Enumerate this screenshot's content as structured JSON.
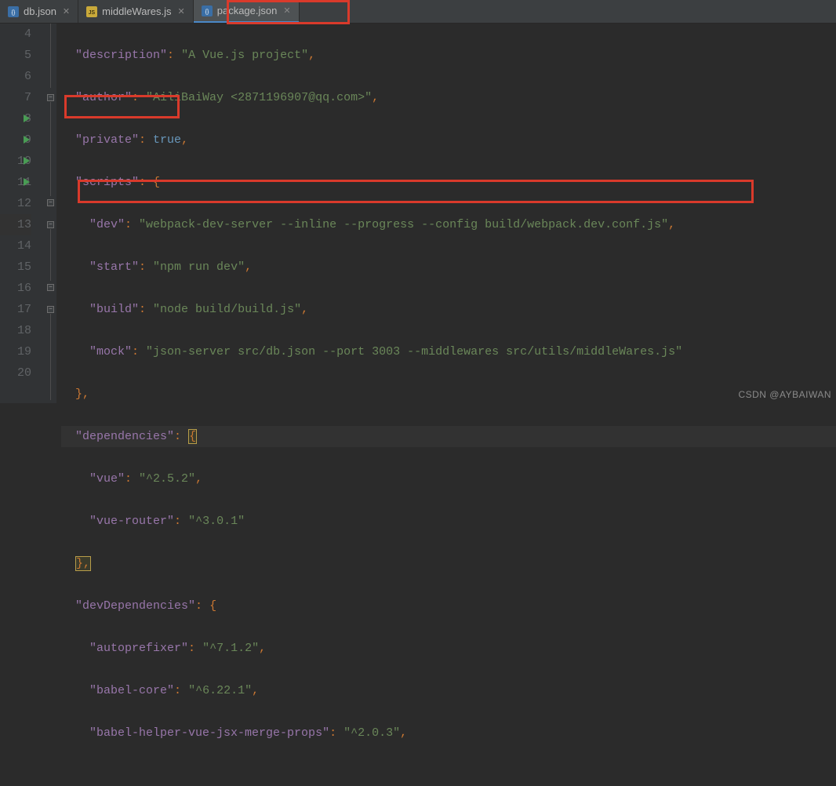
{
  "tabs": [
    {
      "label": "db.json",
      "icon": "json-icon",
      "active": false
    },
    {
      "label": "middleWares.js",
      "icon": "js-icon",
      "active": false
    },
    {
      "label": "package.json",
      "icon": "json-icon",
      "active": true
    }
  ],
  "line_numbers": [
    "4",
    "5",
    "6",
    "7",
    "8",
    "9",
    "10",
    "11",
    "12",
    "13",
    "14",
    "15",
    "16",
    "17",
    "18",
    "19",
    "20"
  ],
  "run_markers_at": [
    8,
    9,
    10,
    11
  ],
  "code": {
    "l4": {
      "key": "\"description\"",
      "val": "\"A Vue.js project\""
    },
    "l5": {
      "key": "\"author\"",
      "val": "\"AiliBaiWay <2871196907@qq.com>\""
    },
    "l6": {
      "key": "\"private\"",
      "val": "true"
    },
    "l7": {
      "key": "\"scripts\"",
      "brace": "{"
    },
    "l8": {
      "key": "\"dev\"",
      "val": "\"webpack-dev-server --inline --progress --config build/webpack.dev.conf.js\""
    },
    "l9": {
      "key": "\"start\"",
      "val": "\"npm run dev\""
    },
    "l10": {
      "key": "\"build\"",
      "val": "\"node build/build.js\""
    },
    "l11": {
      "key": "\"mock\"",
      "val": "\"json-server src/db.json --port 3003 --middlewares src/utils/middleWares.js\""
    },
    "l12": {
      "close": "},"
    },
    "l13": {
      "key": "\"dependencies\"",
      "brace": "{"
    },
    "l14": {
      "key": "\"vue\"",
      "val": "\"^2.5.2\""
    },
    "l15": {
      "key": "\"vue-router\"",
      "val": "\"^3.0.1\""
    },
    "l16": {
      "close": "},"
    },
    "l17": {
      "key": "\"devDependencies\"",
      "brace": "{"
    },
    "l18": {
      "key": "\"autoprefixer\"",
      "val": "\"^7.1.2\""
    },
    "l19": {
      "key": "\"babel-core\"",
      "val": "\"^6.22.1\""
    },
    "l20": {
      "key": "\"babel-helper-vue-jsx-merge-props\"",
      "val": "\"^2.0.3\""
    }
  },
  "watermark": "CSDN @AYBAIWAN"
}
